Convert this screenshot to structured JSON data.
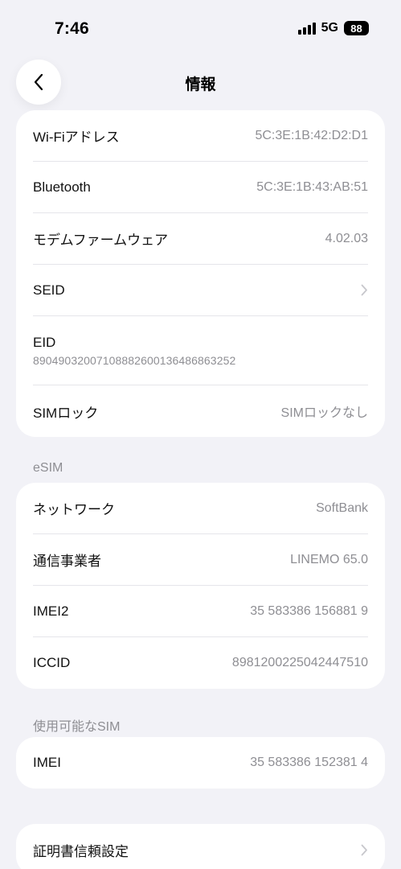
{
  "status_bar": {
    "time": "7:46",
    "network": "5G",
    "battery": "88"
  },
  "nav": {
    "title": "情報"
  },
  "groups": {
    "device": [
      {
        "label": "Wi-Fiアドレス",
        "value": "5C:3E:1B:42:D2:D1"
      },
      {
        "label": "Bluetooth",
        "value": "5C:3E:1B:43:AB:51"
      },
      {
        "label": "モデムファームウェア",
        "value": "4.02.03"
      },
      {
        "label": "SEID",
        "value": ""
      },
      {
        "label": "EID",
        "value": "89049032007108882600136486863252"
      },
      {
        "label": "SIMロック",
        "value": "SIMロックなし"
      }
    ],
    "esim_header": "eSIM",
    "esim": [
      {
        "label": "ネットワーク",
        "value": "SoftBank"
      },
      {
        "label": "通信事業者",
        "value": "LINEMO 65.0"
      },
      {
        "label": "IMEI2",
        "value": "35 583386 156881 9"
      },
      {
        "label": "ICCID",
        "value": "8981200225042447510"
      }
    ],
    "available_sim_header": "使用可能なSIM",
    "available_sim": [
      {
        "label": "IMEI",
        "value": "35 583386 152381 4"
      }
    ],
    "certificates": [
      {
        "label": "証明書信頼設定",
        "value": ""
      }
    ]
  },
  "icons": {
    "back": "chevron-left-icon",
    "disclosure": "chevron-right-icon"
  }
}
